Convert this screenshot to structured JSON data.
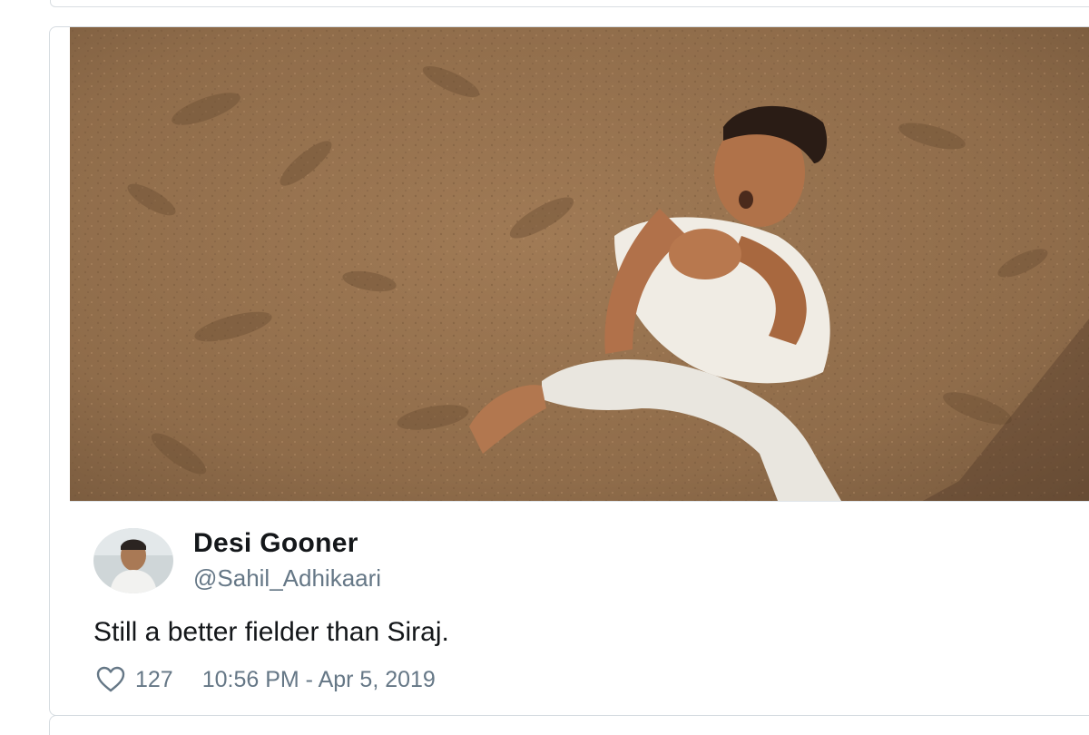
{
  "tweet": {
    "display_name": "Desi Gooner",
    "handle": "@Sahil_Adhikaari",
    "text": "Still a better fielder than Siraj.",
    "likes": "127",
    "timestamp": "10:56 PM - Apr 5, 2019",
    "media_description_icon": "photo-of-man-catching",
    "avatar_icon": "user-avatar",
    "brand_icon": "twitter-bird-icon",
    "like_icon": "heart-icon"
  },
  "colors": {
    "twitter_blue": "#1da1f2",
    "text_primary": "#14171a",
    "text_secondary": "#657786",
    "border": "#d6dce1"
  }
}
